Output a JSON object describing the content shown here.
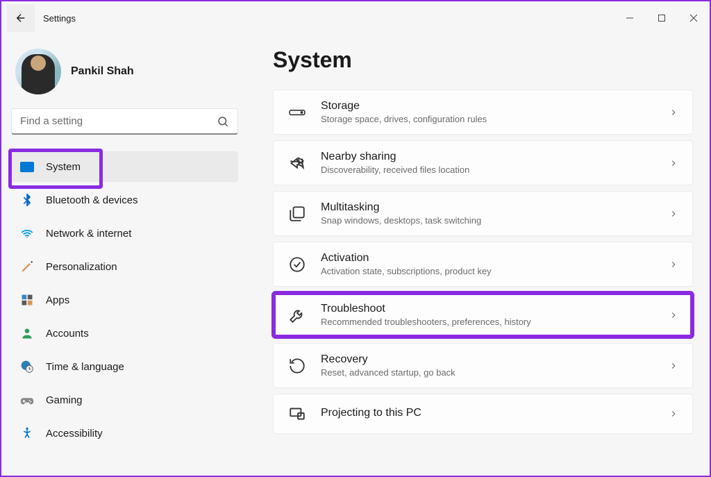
{
  "app_title": "Settings",
  "username": "Pankil Shah",
  "search_placeholder": "Find a setting",
  "page_title": "System",
  "nav": [
    {
      "key": "system",
      "label": "System"
    },
    {
      "key": "bluetooth",
      "label": "Bluetooth & devices"
    },
    {
      "key": "network",
      "label": "Network & internet"
    },
    {
      "key": "personalization",
      "label": "Personalization"
    },
    {
      "key": "apps",
      "label": "Apps"
    },
    {
      "key": "accounts",
      "label": "Accounts"
    },
    {
      "key": "time",
      "label": "Time & language"
    },
    {
      "key": "gaming",
      "label": "Gaming"
    },
    {
      "key": "accessibility",
      "label": "Accessibility"
    }
  ],
  "settings": [
    {
      "key": "storage",
      "title": "Storage",
      "subtitle": "Storage space, drives, configuration rules"
    },
    {
      "key": "nearby",
      "title": "Nearby sharing",
      "subtitle": "Discoverability, received files location"
    },
    {
      "key": "multitasking",
      "title": "Multitasking",
      "subtitle": "Snap windows, desktops, task switching"
    },
    {
      "key": "activation",
      "title": "Activation",
      "subtitle": "Activation state, subscriptions, product key"
    },
    {
      "key": "troubleshoot",
      "title": "Troubleshoot",
      "subtitle": "Recommended troubleshooters, preferences, history"
    },
    {
      "key": "recovery",
      "title": "Recovery",
      "subtitle": "Reset, advanced startup, go back"
    },
    {
      "key": "projecting",
      "title": "Projecting to this PC",
      "subtitle": ""
    }
  ],
  "highlight": {
    "nav": "system",
    "setting": "troubleshoot"
  }
}
